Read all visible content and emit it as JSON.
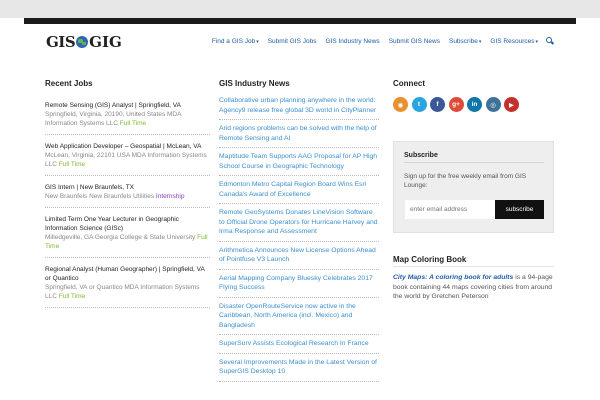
{
  "header": {
    "logo_left": "GIS",
    "logo_right": "GIG",
    "nav": [
      {
        "label": "Find a GIS Job",
        "dropdown": true
      },
      {
        "label": "Submit GIS Jobs",
        "dropdown": false
      },
      {
        "label": "GIS Industry News",
        "dropdown": false
      },
      {
        "label": "Submit GIS News",
        "dropdown": false
      },
      {
        "label": "Subscribe",
        "dropdown": true
      },
      {
        "label": "GIS Resources",
        "dropdown": true
      }
    ],
    "caret": "▾",
    "search_icon": "search-icon"
  },
  "jobs": {
    "title": "Recent Jobs",
    "items": [
      {
        "title": "Remote Sensing (GIS) Analyst | Springfield, VA",
        "meta": "Springfield, Virginia, 20190, United States    MDA Information Systems LLC",
        "type": "Full Time",
        "type_class": "ft"
      },
      {
        "title": "Web Application Developer – Geospatial | McLean, VA",
        "meta": "McLean, Virginia, 22101 USA    MDA Information Systems LLC",
        "type": "Full Time",
        "type_class": "ft"
      },
      {
        "title": "GIS Intern | New Braunfels, TX",
        "meta": "New Braunfels    New Braunfels Utilities",
        "type": "Internship",
        "type_class": "intern"
      },
      {
        "title": "Limited Term One Year Lecturer in Geographic Information Science (GISc)",
        "meta": "Milledgeville, GA    Georgia College & State University",
        "type": "Full Time",
        "type_class": "ft"
      },
      {
        "title": "Regional Analyst (Human Geographer) | Springfield, VA or Quantico",
        "meta": "Springfield, VA or Quantico    MDA Information Systems LLC",
        "type": "Full Time",
        "type_class": "ft"
      }
    ]
  },
  "news": {
    "title": "GIS Industry News",
    "items": [
      "Collaborative urban planning anywhere in the world: Agency9 release free global 3D world in CityPlanner",
      "Arid regions problems can be solved with the help of Remote Sensing and AI",
      "Maptitude Team Supports AAG Proposal for AP High School Course in Geographic Technology",
      "Edmonton Metro Capital Region Board Wins Esri Canada's Award of Excellence",
      "Remote GeoSystems Donates LineVision Software to Official Drone Operators for Hurricane Harvey and Irma Response and Assessment",
      "Arithmetica Announces New License Options Ahead of Pointfuse V3 Launch",
      "Aerial Mapping Company Bluesky Celebrates 2017 Flying Success",
      "Disaster OpenRouteService now active in the Caribbean, North America (incl. Mexico) and Bangladesh",
      "SuperSurv Assists Ecological Research In France",
      "Several Improvements Made in the Latest Version of SuperGIS Desktop 10"
    ]
  },
  "connect": {
    "title": "Connect",
    "icons": [
      {
        "name": "rss-icon",
        "glyph": "◉",
        "color": "#e8912d"
      },
      {
        "name": "twitter-icon",
        "glyph": "t",
        "color": "#2aa4df"
      },
      {
        "name": "facebook-icon",
        "glyph": "f",
        "color": "#3b5998"
      },
      {
        "name": "google-plus-icon",
        "glyph": "g+",
        "color": "#dd4b39"
      },
      {
        "name": "linkedin-icon",
        "glyph": "in",
        "color": "#0e76a8"
      },
      {
        "name": "instagram-icon",
        "glyph": "◎",
        "color": "#3f729b"
      },
      {
        "name": "youtube-icon",
        "glyph": "▶",
        "color": "#c4302b"
      }
    ]
  },
  "subscribe": {
    "title": "Subscribe",
    "text": "Sign up for the free weekly email from GIS Lounge:",
    "placeholder": "enter email address",
    "button": "subscribe"
  },
  "map_book": {
    "title": "Map Coloring Book",
    "link": "City Maps: A coloring book for adults",
    "text": " is a 94-page book containing 44 maps covering cities from around the world by Gretchen Peterson"
  }
}
